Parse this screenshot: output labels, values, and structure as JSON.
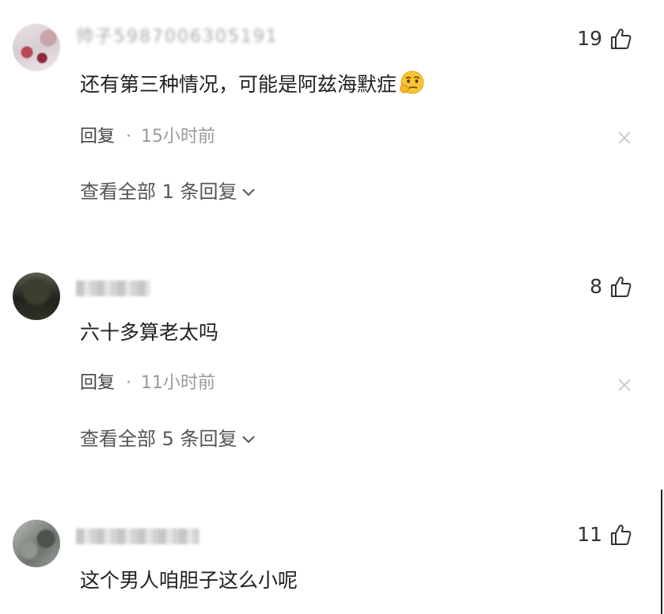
{
  "comments": [
    {
      "username": "帅子5987006305191",
      "like_count": "19",
      "content": "还有第三种情况，可能是阿兹海默症",
      "emoji_name": "thinking-face-emoji",
      "reply_label": "回复",
      "separator": "·",
      "time": "15小时前",
      "view_replies": "查看全部 1 条回复"
    },
    {
      "username": "",
      "like_count": "8",
      "content": "六十多算老太吗",
      "reply_label": "回复",
      "separator": "·",
      "time": "11小时前",
      "view_replies": "查看全部 5 条回复"
    },
    {
      "username": "",
      "like_count": "11",
      "content": "这个男人咱胆子这么小呢"
    }
  ],
  "icons": {
    "like": "thumbs-up-icon",
    "close": "close-icon",
    "expand": "chevron-down-icon"
  },
  "colors": {
    "text": "#222222",
    "meta": "#9a9a9a",
    "link": "#555555"
  }
}
